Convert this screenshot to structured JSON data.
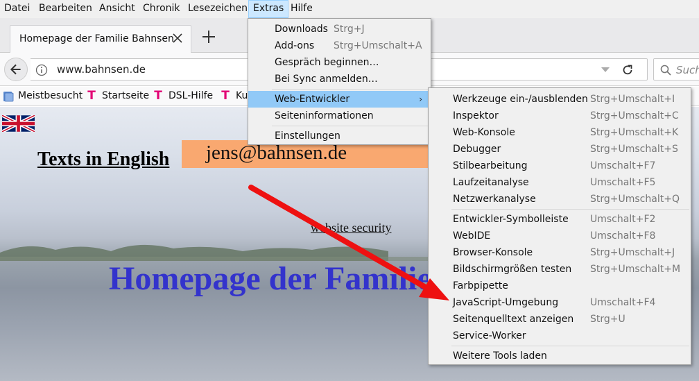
{
  "menubar": {
    "items": [
      "Datei",
      "Bearbeiten",
      "Ansicht",
      "Chronik",
      "Lesezeichen",
      "Extras",
      "Hilfe"
    ]
  },
  "tab": {
    "title": "Homepage der Familie Bahnsen"
  },
  "navbar": {
    "url": "www.bahnsen.de",
    "search_placeholder": "Such"
  },
  "bookmarks": {
    "items": [
      "Meistbesucht",
      "Startseite",
      "DSL-Hilfe",
      "Ku"
    ]
  },
  "page": {
    "english_link": "Texts in English",
    "email": "jens@bahnsen.de",
    "security_link": "website security",
    "heading": "Homepage der Familie Bahnsen"
  },
  "extras_menu": {
    "items": [
      {
        "label": "Downloads",
        "shortcut": "Strg+J"
      },
      {
        "label": "Add-ons",
        "shortcut": "Strg+Umschalt+A"
      },
      {
        "label": "Gespräch beginnen…",
        "shortcut": ""
      },
      {
        "label": "Bei Sync anmelden…",
        "shortcut": ""
      },
      {
        "label": "Web-Entwickler",
        "shortcut": ""
      },
      {
        "label": "Seiteninformationen",
        "shortcut": ""
      },
      {
        "label": "Einstellungen",
        "shortcut": ""
      }
    ]
  },
  "dev_menu": {
    "items": [
      {
        "label": "Werkzeuge ein-/ausblenden",
        "shortcut": "Strg+Umschalt+I"
      },
      {
        "label": "Inspektor",
        "shortcut": "Strg+Umschalt+C"
      },
      {
        "label": "Web-Konsole",
        "shortcut": "Strg+Umschalt+K"
      },
      {
        "label": "Debugger",
        "shortcut": "Strg+Umschalt+S"
      },
      {
        "label": "Stilbearbeitung",
        "shortcut": "Umschalt+F7"
      },
      {
        "label": "Laufzeitanalyse",
        "shortcut": "Umschalt+F5"
      },
      {
        "label": "Netzwerkanalyse",
        "shortcut": "Strg+Umschalt+Q"
      },
      {
        "label": "Entwickler-Symbolleiste",
        "shortcut": "Umschalt+F2"
      },
      {
        "label": "WebIDE",
        "shortcut": "Umschalt+F8"
      },
      {
        "label": "Browser-Konsole",
        "shortcut": "Strg+Umschalt+J"
      },
      {
        "label": "Bildschirmgrößen testen",
        "shortcut": "Strg+Umschalt+M"
      },
      {
        "label": "Farbpipette",
        "shortcut": ""
      },
      {
        "label": "JavaScript-Umgebung",
        "shortcut": "Umschalt+F4"
      },
      {
        "label": "Seitenquelltext anzeigen",
        "shortcut": "Strg+U"
      },
      {
        "label": "Service-Worker",
        "shortcut": ""
      },
      {
        "label": "Weitere Tools laden",
        "shortcut": ""
      }
    ]
  },
  "colors": {
    "heading": "#3333cc",
    "email_bg": "#f9a870",
    "menu_highlight": "#91c9f7",
    "arrow": "#ee1111",
    "telekom": "#e20074"
  }
}
